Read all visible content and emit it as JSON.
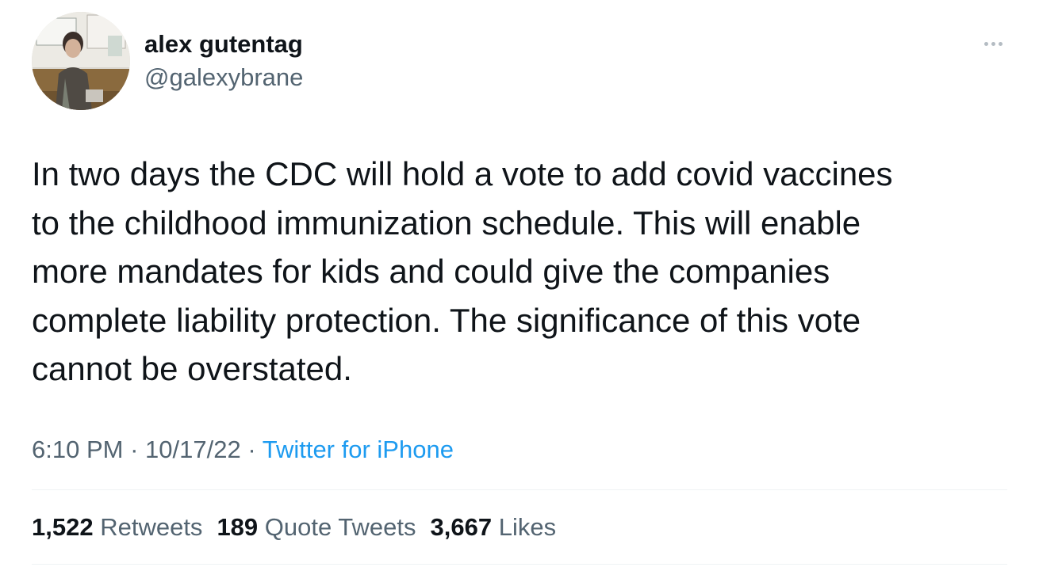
{
  "author": {
    "name": "alex gutentag",
    "handle": "@galexybrane"
  },
  "tweet": {
    "text": "In two days the CDC will hold a vote to add covid vaccines\nto the childhood immunization schedule. This will enable\nmore mandates for kids and could give the companies\ncomplete liability protection. The significance of this vote\ncannot be overstated."
  },
  "meta": {
    "time": "6:10 PM",
    "separator": "·",
    "date": "10/17/22",
    "source": "Twitter for iPhone"
  },
  "stats": {
    "retweets_count": "1,522",
    "retweets_label": "Retweets",
    "quotes_count": "189",
    "quotes_label": "Quote Tweets",
    "likes_count": "3,667",
    "likes_label": "Likes"
  },
  "icons": {
    "more": "more-dots-icon",
    "avatar": "avatar-photo"
  },
  "colors": {
    "text_primary": "#0f1419",
    "text_secondary": "#536471",
    "link": "#1d9bf0",
    "divider": "#eff3f4"
  }
}
